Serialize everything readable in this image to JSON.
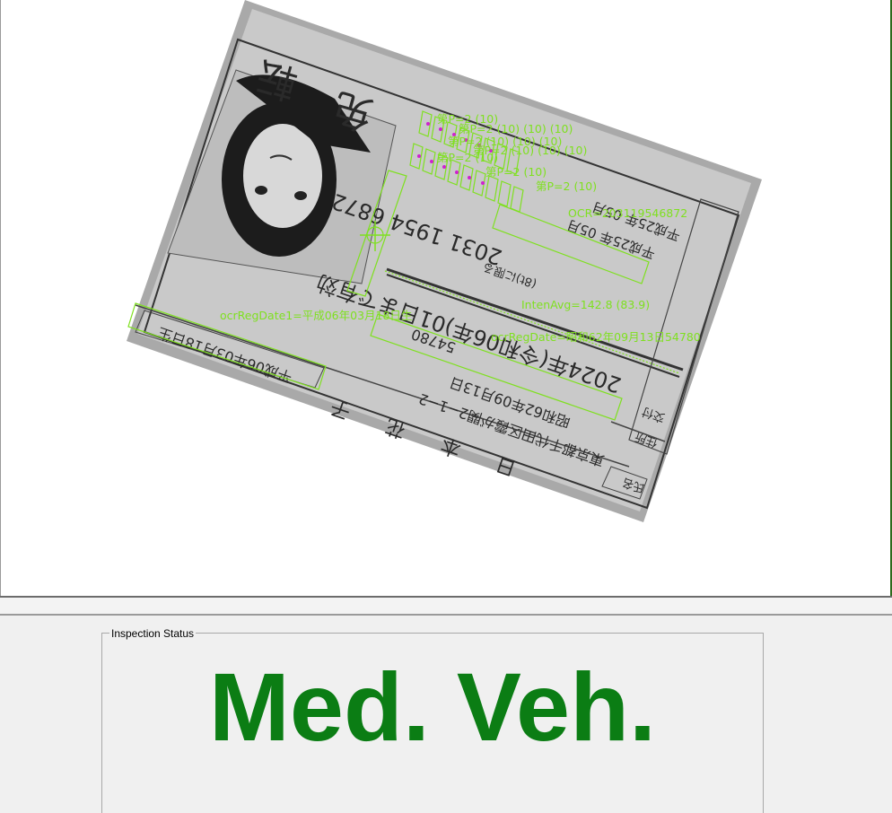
{
  "inspection": {
    "group_label": "Inspection Status",
    "status": "Med. Veh.",
    "status_color": "#0b7d14"
  },
  "overlay": {
    "color": "#7fe020",
    "ocr_number": "OCR=203119546872",
    "inten_avg": "IntenAvg=142.8 (83.9)",
    "ocr_reg_date1": "ocrRegDate1=平成06年03月18日生",
    "ocr_reg_date2": "ocrRegDate=昭和62年09月13日54780",
    "char_score": "第P=2 (10)",
    "char_score_top": "第P=2 (10)"
  },
  "card": {
    "license_number": "2031 1954 6872",
    "birth_date": "平成06年03月18日生",
    "expiry": "2024年(令和06年)01日まで有効",
    "issue_date": "昭和62年09月13日",
    "issue_number": "54780",
    "address": "東京都千代田区霞が関2−1−2",
    "name": "日 本 花 子",
    "label_name": "氏名",
    "label_address": "住所",
    "label_issue": "交付",
    "label_number": "番号",
    "condition": "眼鏡等",
    "dates_1": "平成25年 05月",
    "dates_2": "平成25年 05月",
    "small_note": "(8t)に限る"
  }
}
